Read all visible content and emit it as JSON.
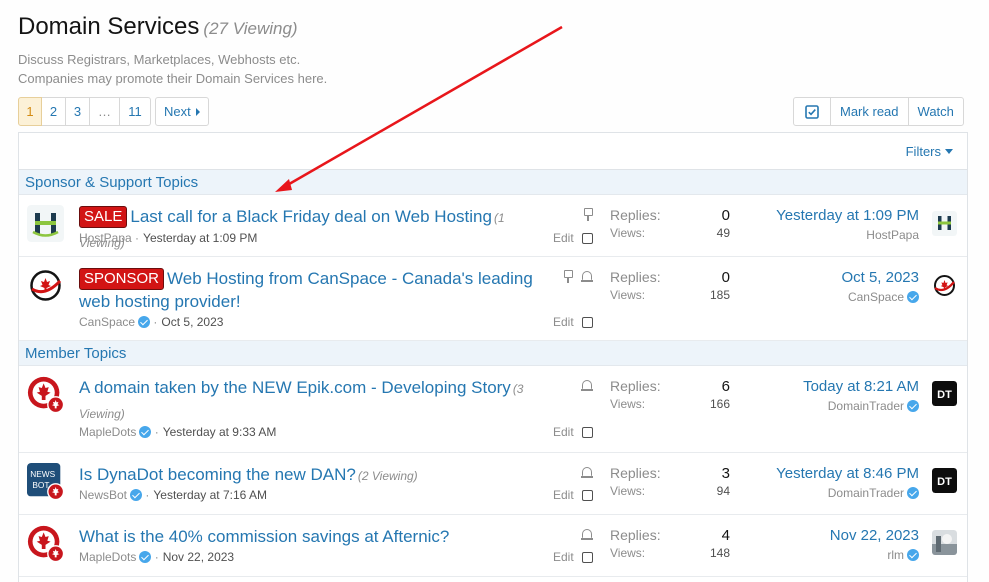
{
  "header": {
    "title": "Domain Services",
    "viewing": "(27 Viewing)",
    "desc_line1": "Discuss Registrars, Marketplaces, Webhosts etc.",
    "desc_line2": "Companies may promote their Domain Services here."
  },
  "pagination": {
    "pages": [
      "1",
      "2",
      "3",
      "…",
      "11"
    ],
    "current": "1",
    "next_label": "Next"
  },
  "actions": {
    "mark_read": "Mark read",
    "watch": "Watch",
    "select_icon": "checkbox-icon"
  },
  "filters_label": "Filters",
  "sections": {
    "sponsor": "Sponsor & Support Topics",
    "member": "Member Topics"
  },
  "threads": [
    {
      "label": "SALE",
      "title": "Last call for a Black Friday deal on Web Hosting",
      "viewing": "(1 Viewing)",
      "author": "HostPapa",
      "date": "Yesterday at 1:09 PM",
      "edit": "Edit",
      "replies_label": "Replies:",
      "replies": "0",
      "views_label": "Views:",
      "views": "49",
      "last_date": "Yesterday at 1:09 PM",
      "last_user": "HostPapa",
      "author_verified": false,
      "last_verified": false
    },
    {
      "label": "SPONSOR",
      "title": "Web Hosting from CanSpace - Canada's leading web hosting provider!",
      "viewing": "",
      "author": "CanSpace",
      "date": "Oct 5, 2023",
      "edit": "Edit",
      "replies_label": "Replies:",
      "replies": "0",
      "views_label": "Views:",
      "views": "185",
      "last_date": "Oct 5, 2023",
      "last_user": "CanSpace",
      "author_verified": true,
      "last_verified": true
    },
    {
      "label": "",
      "title": "A domain taken by the NEW Epik.com - Developing Story",
      "viewing": "(3 Viewing)",
      "author": "MapleDots",
      "date": "Yesterday at 9:33 AM",
      "edit": "Edit",
      "replies_label": "Replies:",
      "replies": "6",
      "views_label": "Views:",
      "views": "166",
      "last_date": "Today at 8:21 AM",
      "last_user": "DomainTrader",
      "author_verified": true,
      "last_verified": true
    },
    {
      "label": "",
      "title": "Is DynaDot becoming the new DAN?",
      "viewing": "(2 Viewing)",
      "author": "NewsBot",
      "date": "Yesterday at 7:16 AM",
      "edit": "Edit",
      "replies_label": "Replies:",
      "replies": "3",
      "views_label": "Views:",
      "views": "94",
      "last_date": "Yesterday at 8:46 PM",
      "last_user": "DomainTrader",
      "author_verified": true,
      "last_verified": true
    },
    {
      "label": "",
      "title": "What is the 40% commission savings at Afternic?",
      "viewing": "",
      "author": "MapleDots",
      "date": "Nov 22, 2023",
      "edit": "Edit",
      "replies_label": "Replies:",
      "replies": "4",
      "views_label": "Views:",
      "views": "148",
      "last_date": "Nov 22, 2023",
      "last_user": "rlm",
      "author_verified": true,
      "last_verified": true
    }
  ],
  "avatar_text": {
    "newsbot": "NEWS BOT",
    "dt": "DT"
  },
  "colors": {
    "link": "#2577b1",
    "label_red": "#d21414",
    "annotation_arrow": "#e8161b"
  }
}
